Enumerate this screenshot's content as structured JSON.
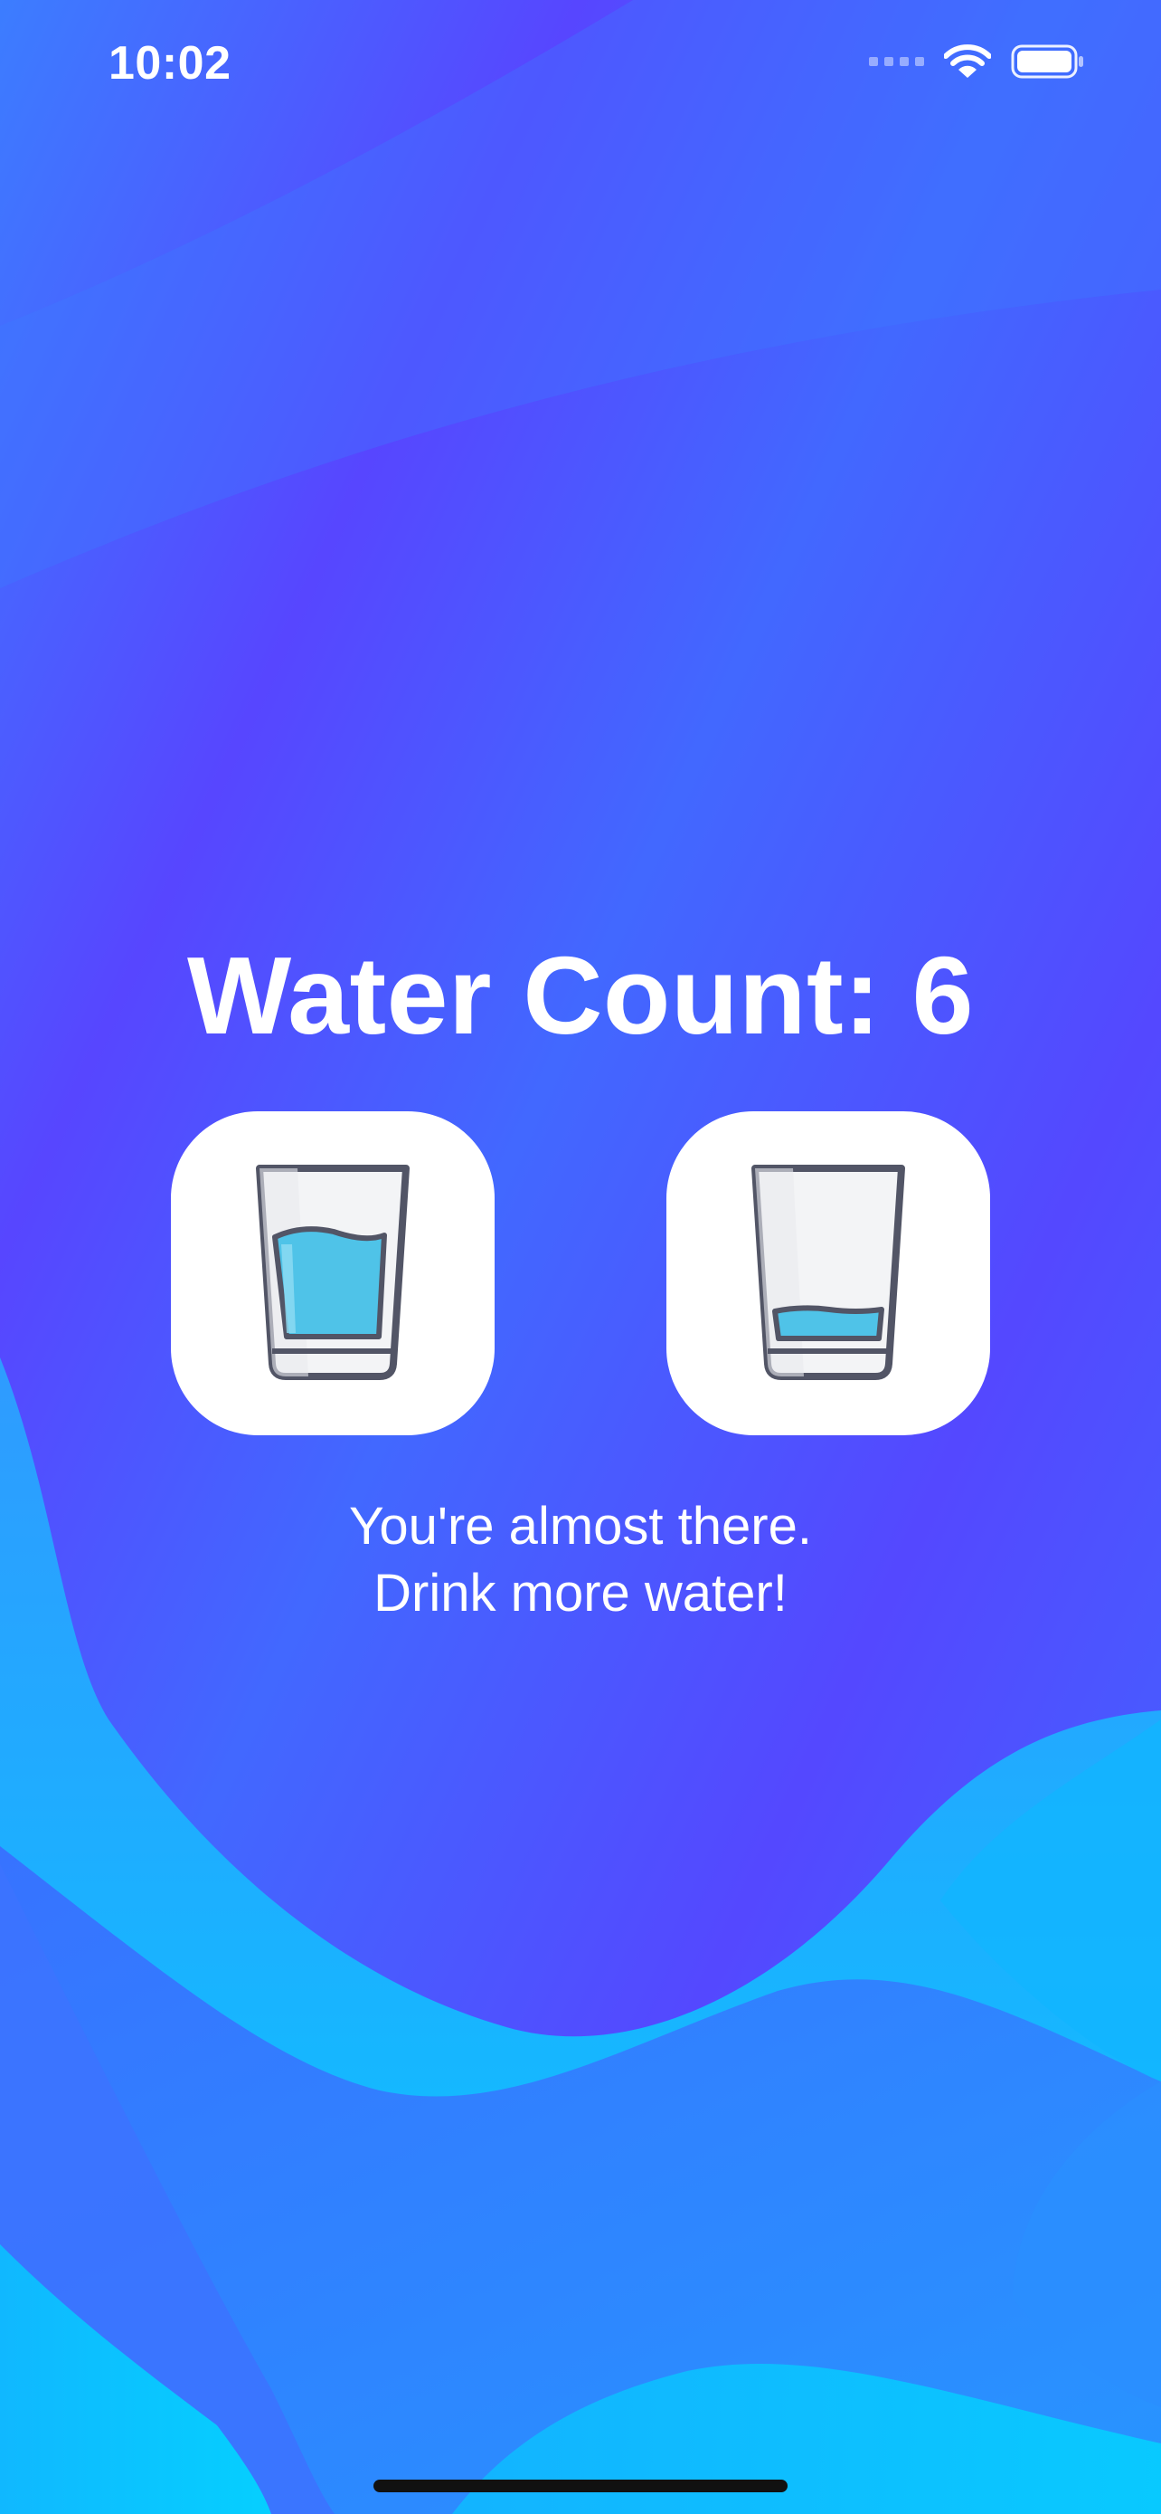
{
  "status_bar": {
    "time": "10:02",
    "icons": [
      "cellular-signal-icon",
      "wifi-icon",
      "battery-icon"
    ]
  },
  "main": {
    "title": "Water Count: 6",
    "buttons": [
      {
        "name": "full-glass-button",
        "icon": "full-glass-icon",
        "fill_level": 0.75
      },
      {
        "name": "empty-glass-button",
        "icon": "empty-glass-icon",
        "fill_level": 0.12
      }
    ],
    "message_line1": "You're almost there.",
    "message_line2": "Drink more water!"
  },
  "colors": {
    "background_violet": "#5647ff",
    "background_blue": "#3b7bff",
    "wave_cyan": "#07c6ff",
    "text": "#ffffff",
    "glass_outline": "#525566",
    "water": "#4fc3e8"
  }
}
